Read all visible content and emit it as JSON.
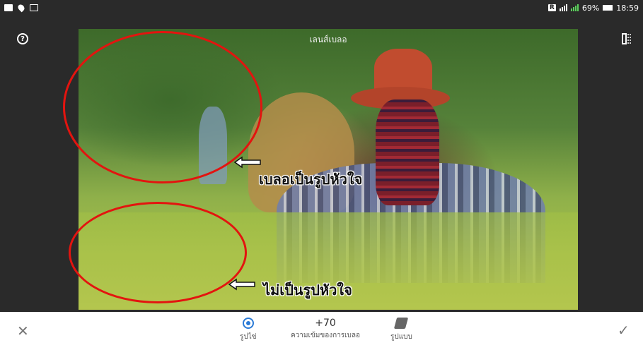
{
  "status_bar": {
    "signal_label": "R",
    "battery": "69%",
    "time": "18:59"
  },
  "editor": {
    "photo_title": "เลนส์เบลอ",
    "help_icon": "help-circle-icon",
    "compare_icon": "compare-icon"
  },
  "annotations": {
    "note_1": "เบลอเป็นรูปหัวใจ",
    "note_2": "ไม่เป็นรูปหัวใจ",
    "ellipse_color": "#e3140f"
  },
  "toolbar": {
    "cancel_icon": "close-icon",
    "apply_icon": "checkmark-icon",
    "tools": [
      {
        "label": "รูปไข่",
        "icon": "ellipse-target-icon"
      },
      {
        "value": "+70",
        "label": "ความเข้มของการเบลอ"
      },
      {
        "label": "รูปแบบ",
        "icon": "style-cards-icon"
      }
    ]
  }
}
